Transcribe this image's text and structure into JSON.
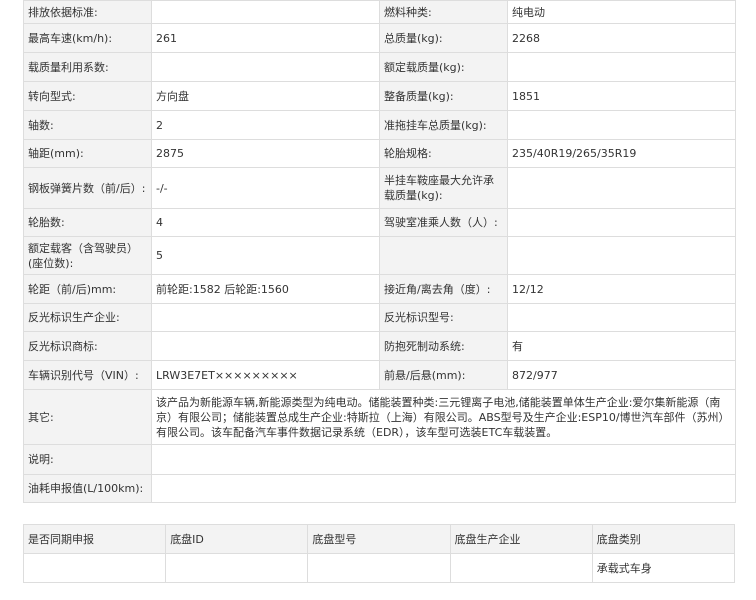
{
  "spec_rows": [
    {
      "l1": "排放依据标准:",
      "v1": "",
      "l2": "燃料种类:",
      "v2": "纯电动"
    },
    {
      "l1": "最高车速(km/h):",
      "v1": "261",
      "l2": "总质量(kg):",
      "v2": "2268"
    },
    {
      "l1": "载质量利用系数:",
      "v1": "",
      "l2": "额定载质量(kg):",
      "v2": ""
    },
    {
      "l1": "转向型式:",
      "v1": "方向盘",
      "l2": "整备质量(kg):",
      "v2": "1851"
    },
    {
      "l1": "轴数:",
      "v1": "2",
      "l2": "准拖挂车总质量(kg):",
      "v2": ""
    },
    {
      "l1": "轴距(mm):",
      "v1": "2875",
      "l2": "轮胎规格:",
      "v2": "235/40R19/265/35R19"
    },
    {
      "l1": "钢板弹簧片数（前/后）:",
      "v1": "-/-",
      "l2": "半挂车鞍座最大允许承载质量(kg):",
      "v2": ""
    },
    {
      "l1": "轮胎数:",
      "v1": "4",
      "l2": "驾驶室准乘人数（人）:",
      "v2": ""
    },
    {
      "l1": "额定载客（含驾驶员）(座位数):",
      "v1": "5",
      "l2": "",
      "v2": ""
    },
    {
      "l1": "轮距（前/后)mm:",
      "v1": "前轮距:1582 后轮距:1560",
      "l2": "接近角/离去角（度）:",
      "v2": "12/12"
    },
    {
      "l1": "反光标识生产企业:",
      "v1": "",
      "l2": "反光标识型号:",
      "v2": ""
    },
    {
      "l1": "反光标识商标:",
      "v1": "",
      "l2": "防抱死制动系统:",
      "v2": "有"
    },
    {
      "l1": "车辆识别代号（VIN）:",
      "v1": "LRW3E7ET×××××××××",
      "l2": "前悬/后悬(mm):",
      "v2": "872/977"
    }
  ],
  "other": {
    "label": "其它:",
    "value": "该产品为新能源车辆,新能源类型为纯电动。储能装置种类:三元锂离子电池,储能装置单体生产企业:爱尔集新能源（南京）有限公司；储能装置总成生产企业:特斯拉（上海）有限公司。ABS型号及生产企业:ESP10/博世汽车部件（苏州）有限公司。该车配备汽车事件数据记录系统（EDR），该车型可选装ETC车载装置。"
  },
  "note": {
    "label": "说明:",
    "value": ""
  },
  "fuel": {
    "label": "油耗申报值(L/100km):",
    "value": ""
  },
  "chassis": {
    "headers": [
      "是否同期申报",
      "底盘ID",
      "底盘型号",
      "底盘生产企业",
      "底盘类别"
    ],
    "row": [
      "",
      "",
      "",
      "",
      "承载式车身"
    ]
  }
}
